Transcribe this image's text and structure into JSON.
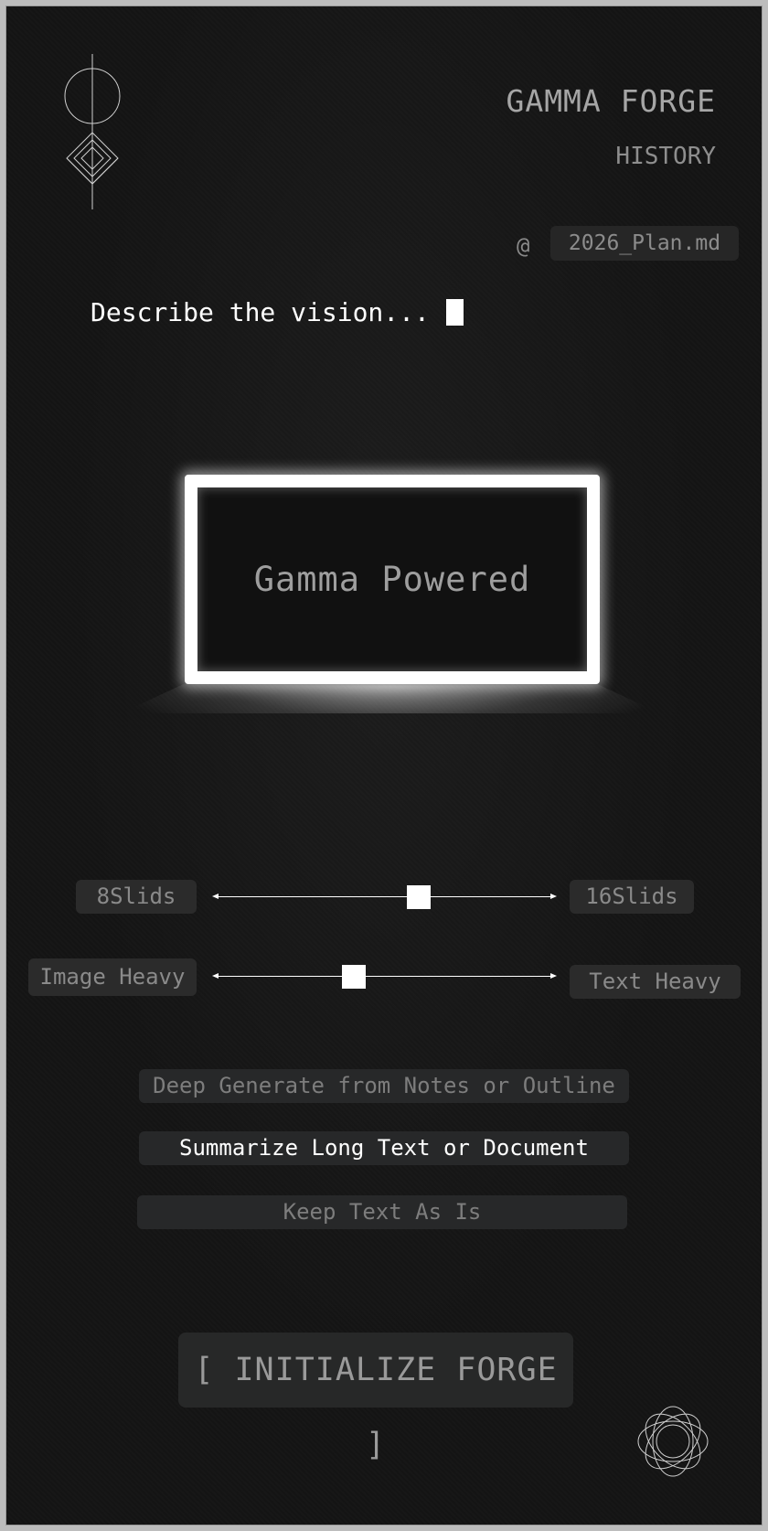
{
  "header": {
    "title": "GAMMA FORGE",
    "history_label": "HISTORY"
  },
  "attachment": {
    "at_symbol": "@",
    "file_name": "2026_Plan.md"
  },
  "prompt": {
    "placeholder": "Describe the vision..."
  },
  "preview": {
    "label": "Gamma Powered"
  },
  "sliders": {
    "slides": {
      "min_label": "8Slids",
      "max_label": "16Slids",
      "position_fraction": 0.6
    },
    "balance": {
      "left_label": "Image Heavy",
      "right_label": "Text Heavy",
      "position_fraction": 0.41
    }
  },
  "modes": {
    "items": [
      {
        "label": "Deep Generate from Notes or Outline",
        "active": false
      },
      {
        "label": "Summarize Long Text or Document",
        "active": true
      },
      {
        "label": "Keep Text As Is",
        "active": false
      }
    ]
  },
  "action": {
    "initialize_label": "[ INITIALIZE FORGE ]"
  },
  "icons": {
    "logo": "diamond-compass-logo-icon",
    "orbit": "orbit-rings-icon"
  },
  "colors": {
    "background": "#141414",
    "accent": "#ffffff",
    "chip": "#2b2b2b",
    "muted_text": "#8a8a8a"
  }
}
